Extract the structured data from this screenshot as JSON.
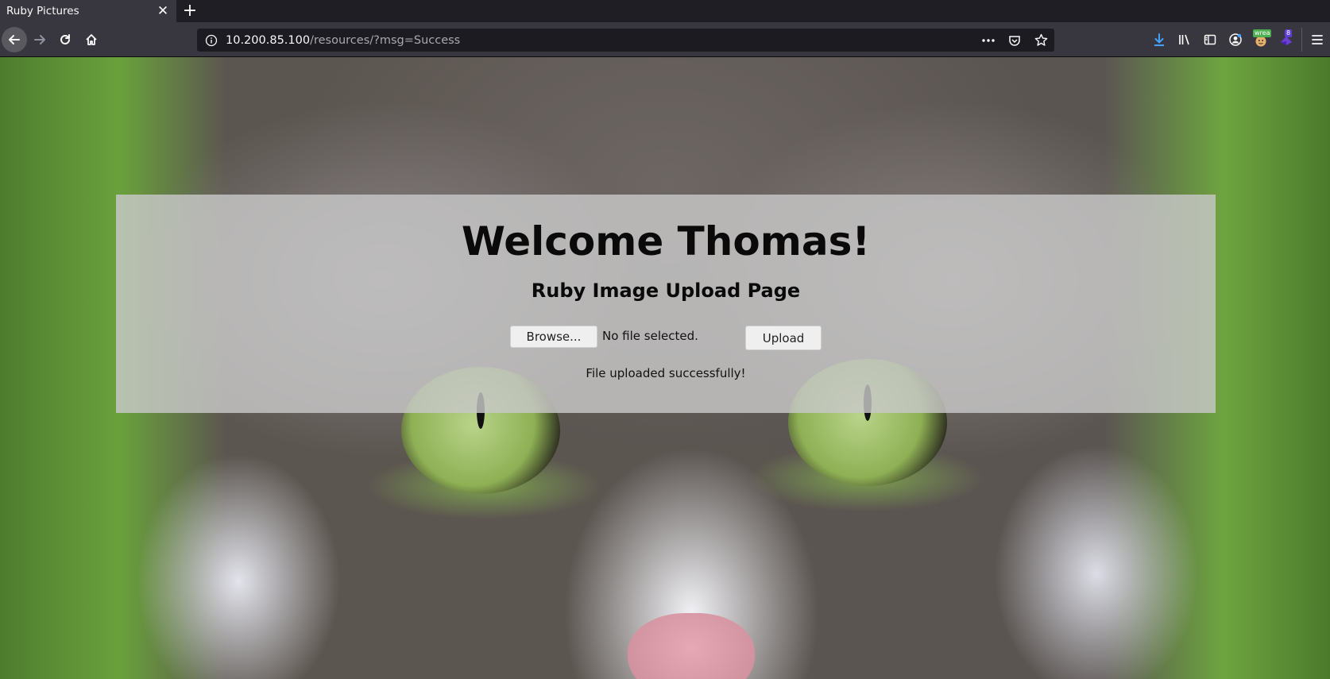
{
  "browser": {
    "tab_title": "Ruby Pictures",
    "url_host": "10.200.85.100",
    "url_path": "/resources/?msg=Success",
    "extension_badges": {
      "wrea": "wrea",
      "count": "8"
    }
  },
  "page": {
    "heading": "Welcome Thomas!",
    "subheading": "Ruby Image Upload Page",
    "browse_label": "Browse...",
    "file_status": "No file selected.",
    "upload_label": "Upload",
    "message": "File uploaded successfully!"
  },
  "colors": {
    "panel_overlay": "#c8c8c8",
    "browser_chrome": "#38373f",
    "download_icon": "#45a1ff"
  }
}
